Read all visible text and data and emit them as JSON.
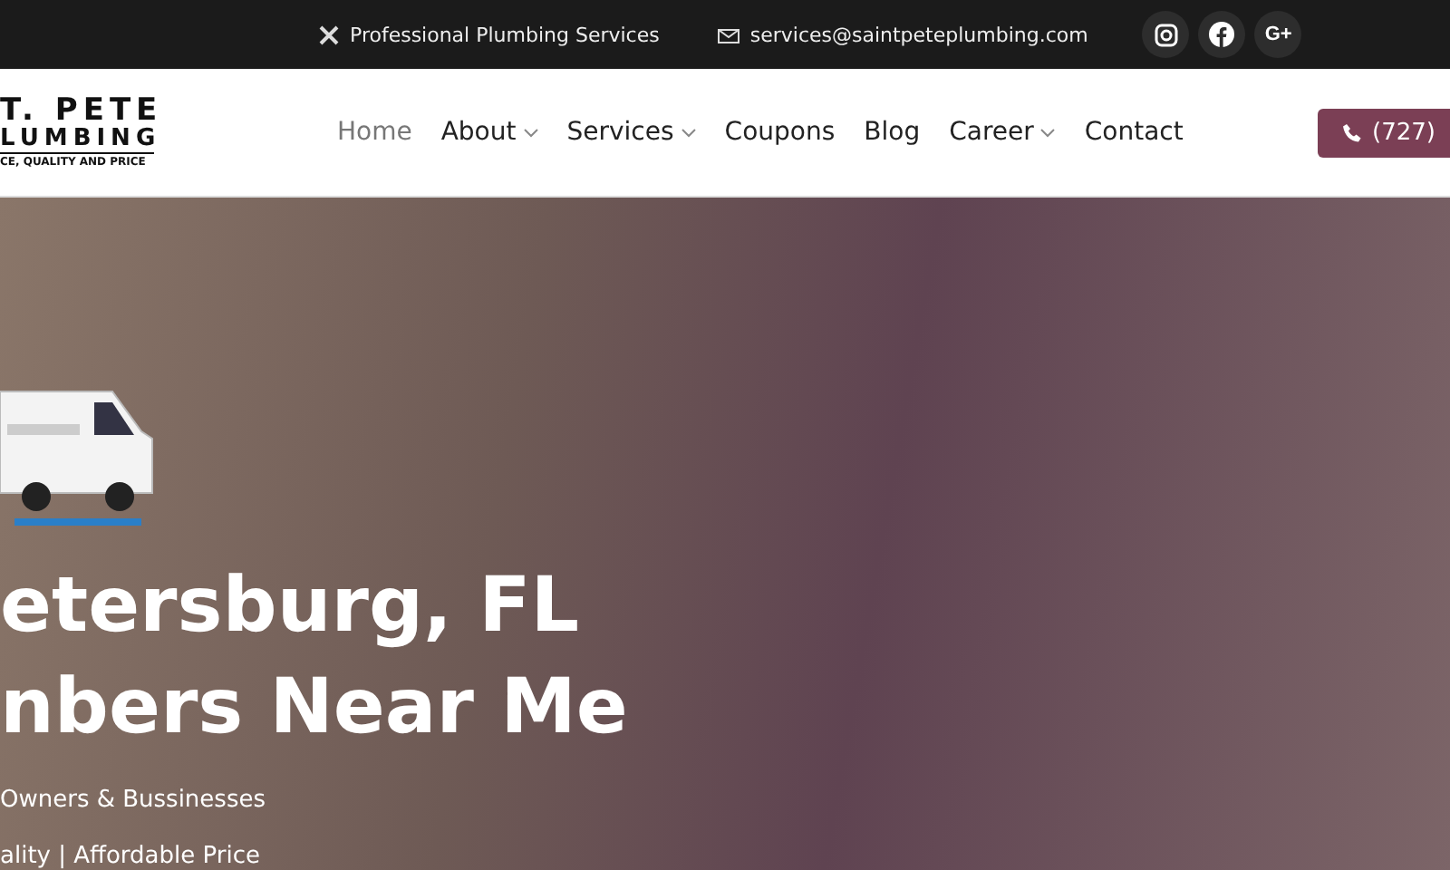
{
  "top_bar": {
    "tagline": "Professional Plumbing Services",
    "email": "services@saintpeteplumbing.com",
    "social": [
      {
        "kind": "instagram"
      },
      {
        "kind": "facebook"
      },
      {
        "kind": "google-plus",
        "label": "G+"
      }
    ]
  },
  "header": {
    "logo": {
      "line_1": "T. PETE",
      "line_2": "LUMBING",
      "tagline": "CE, QUALITY AND PRICE"
    },
    "nav": [
      {
        "label": "Home",
        "selected": true,
        "dropdown": false
      },
      {
        "label": "About",
        "selected": false,
        "dropdown": true
      },
      {
        "label": "Services",
        "selected": false,
        "dropdown": true
      },
      {
        "label": "Coupons",
        "selected": false,
        "dropdown": false
      },
      {
        "label": "Blog",
        "selected": false,
        "dropdown": false
      },
      {
        "label": "Career",
        "selected": false,
        "dropdown": true
      },
      {
        "label": "Contact",
        "selected": false,
        "dropdown": false
      }
    ],
    "phone_button": "(727)"
  },
  "hero": {
    "heading_lines": [
      "etersburg, FL",
      "nbers Near Me"
    ],
    "subtitle": "Owners & Bussinesses",
    "tagline": "ality | Affordable Price"
  }
}
